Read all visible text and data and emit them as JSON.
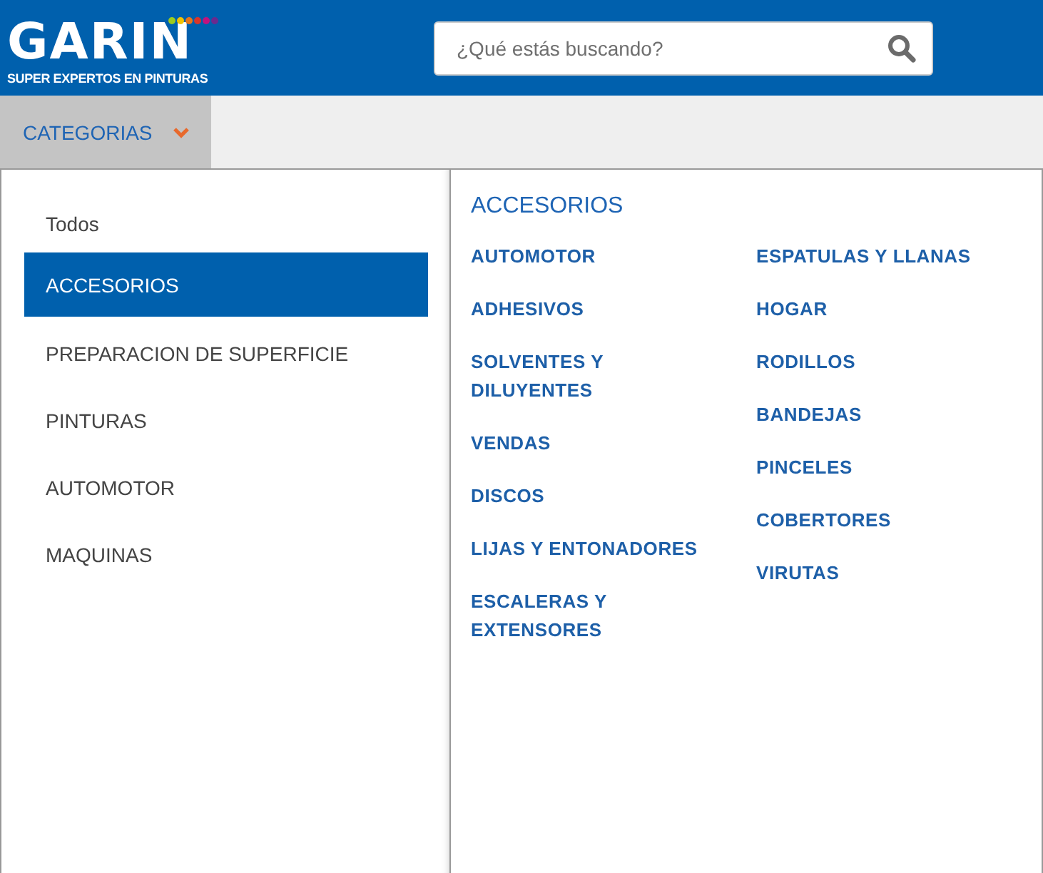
{
  "header": {
    "logo": {
      "name": "GARIN",
      "tagline": "SUPER EXPERTOS EN PINTURAS",
      "dots": [
        {
          "color": "#9ccc1e"
        },
        {
          "color": "#f2c200"
        },
        {
          "color": "#e8761a"
        },
        {
          "color": "#d8362a"
        },
        {
          "color": "#c2127e"
        },
        {
          "color": "#6a2a8e"
        }
      ]
    },
    "search": {
      "placeholder": "¿Qué estás buscando?"
    }
  },
  "nav": {
    "categories_button": {
      "label": "CATEGORIAS",
      "expanded": true
    }
  },
  "menu": {
    "categories": [
      {
        "label": "Todos",
        "selected": false
      },
      {
        "label": "ACCESORIOS",
        "selected": true
      },
      {
        "label": "PREPARACION DE SUPERFICIE",
        "selected": false
      },
      {
        "label": "PINTURAS",
        "selected": false
      },
      {
        "label": "AUTOMOTOR",
        "selected": false
      },
      {
        "label": "MAQUINAS",
        "selected": false
      }
    ],
    "heading": "ACCESORIOS",
    "columns": [
      [
        "AUTOMOTOR",
        "ADHESIVOS",
        "SOLVENTES Y DILUYENTES",
        "VENDAS",
        "DISCOS",
        "LIJAS Y ENTONADORES",
        "ESCALERAS Y EXTENSORES"
      ],
      [
        "ESPATULAS Y LLANAS",
        "HOGAR",
        "RODILLOS",
        "BANDEJAS",
        "PINCELES",
        "COBERTORES",
        "VIRUTAS"
      ]
    ]
  }
}
